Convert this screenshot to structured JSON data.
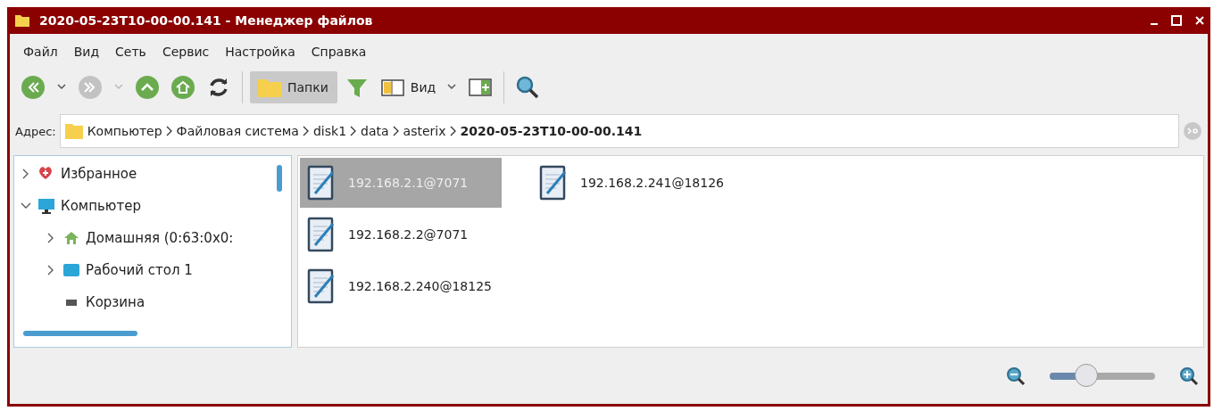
{
  "window": {
    "title": "2020-05-23T10-00-00.141 - Менеджер файлов"
  },
  "menu": [
    "Файл",
    "Вид",
    "Сеть",
    "Сервис",
    "Настройка",
    "Справка"
  ],
  "toolbar": [
    {
      "kind": "back"
    },
    {
      "kind": "dropdown"
    },
    {
      "kind": "forward",
      "disabled": true
    },
    {
      "kind": "dropdown",
      "disabled": true
    },
    {
      "kind": "up"
    },
    {
      "kind": "home"
    },
    {
      "kind": "refresh"
    },
    {
      "kind": "separator"
    },
    {
      "kind": "folders",
      "label": "Папки",
      "selected": true
    },
    {
      "kind": "filter"
    },
    {
      "kind": "view",
      "label": "Вид"
    },
    {
      "kind": "dropdown"
    },
    {
      "kind": "panel"
    },
    {
      "kind": "separator"
    },
    {
      "kind": "search"
    }
  ],
  "address": {
    "label": "Адрес:",
    "crumbs": [
      {
        "text": "Компьютер",
        "current": false
      },
      {
        "text": "Файловая система",
        "current": false
      },
      {
        "text": "disk1",
        "current": false
      },
      {
        "text": "data",
        "current": false
      },
      {
        "text": "asterix",
        "current": false
      },
      {
        "text": "2020-05-23T10-00-00.141",
        "current": true
      }
    ]
  },
  "tree": [
    {
      "label": "Избранное",
      "kind": "favorites",
      "expanded": false
    },
    {
      "label": "Компьютер",
      "kind": "computer",
      "expanded": true,
      "children": [
        {
          "label": "Домашняя (0:63:0x0:",
          "kind": "home",
          "expanded": false
        },
        {
          "label": "Рабочий стол 1",
          "kind": "desktop",
          "expanded": false
        },
        {
          "label": "Корзина",
          "kind": "trash"
        }
      ]
    }
  ],
  "files": [
    {
      "name": "192.168.2.1@7071",
      "selected": true
    },
    {
      "name": "192.168.2.2@7071",
      "selected": false
    },
    {
      "name": "192.168.2.240@18125",
      "selected": false
    },
    {
      "name": "192.168.2.241@18126",
      "selected": false
    }
  ],
  "zoom": {
    "level": 0.35
  }
}
